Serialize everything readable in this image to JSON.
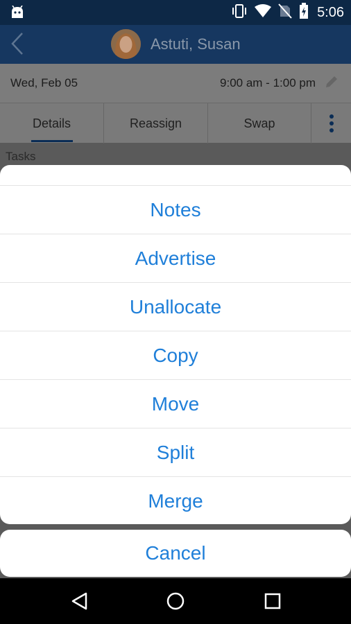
{
  "status_bar": {
    "time": "5:06",
    "icons": [
      "android-icon",
      "vibrate-icon",
      "wifi-icon",
      "no-sim-icon",
      "battery-charging-icon"
    ]
  },
  "app_bar": {
    "title": "Astuti, Susan",
    "back_icon": "chevron-left-icon"
  },
  "shift": {
    "date": "Wed, Feb 05",
    "time_range": "9:00 am - 1:00 pm"
  },
  "tabs": [
    {
      "label": "Details",
      "selected": true
    },
    {
      "label": "Reassign",
      "selected": false
    },
    {
      "label": "Swap",
      "selected": false
    }
  ],
  "section": {
    "tasks_label": "Tasks"
  },
  "action_sheet": {
    "items": [
      "Notes",
      "Advertise",
      "Unallocate",
      "Copy",
      "Move",
      "Split",
      "Merge"
    ],
    "cancel_label": "Cancel"
  },
  "colors": {
    "status_bar": "#0d2846",
    "action_text": "#1f7fd9",
    "tab_indicator": "#0a2c55"
  }
}
